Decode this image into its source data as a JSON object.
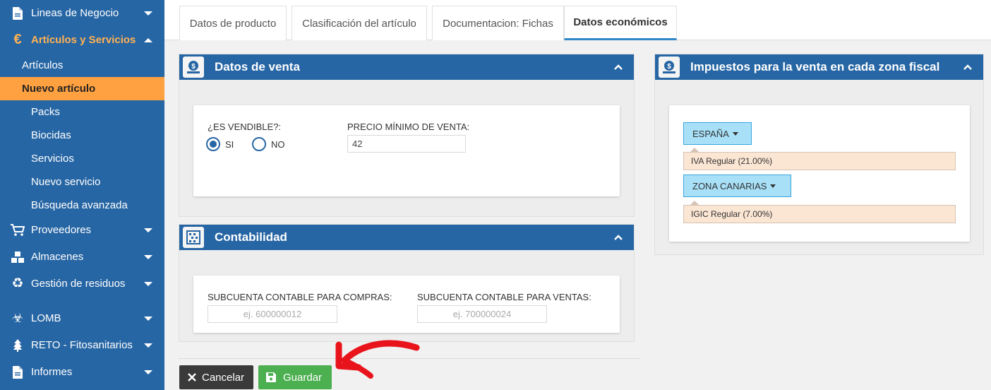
{
  "sidebar": {
    "groups": [
      {
        "label": "Lineas de Negocio",
        "icon": "document-icon"
      },
      {
        "label": "Artículos y Servicios",
        "icon": "euro-icon"
      },
      {
        "label": "Proveedores",
        "icon": "cart-icon"
      },
      {
        "label": "Almacenes",
        "icon": "boxes-icon"
      },
      {
        "label": "Gestión de residuos",
        "icon": "recycle-icon"
      },
      {
        "label": "LOMB",
        "icon": "biohazard-icon"
      },
      {
        "label": "RETO - Fitosanitarios",
        "icon": "tree-icon"
      },
      {
        "label": "Informes",
        "icon": "report-icon"
      }
    ],
    "subitems": [
      "Artículos",
      "Nuevo artículo",
      "Packs",
      "Biocidas",
      "Servicios",
      "Nuevo servicio",
      "Búsqueda avanzada"
    ]
  },
  "tabs": [
    "Datos de producto",
    "Clasificación del artículo",
    "Documentacion: Fichas",
    "Datos económicos"
  ],
  "venta": {
    "title": "Datos de venta",
    "vendible_label": "¿ES VENDIBLE?:",
    "si_label": "SI",
    "no_label": "NO",
    "vendible_value": "SI",
    "precio_label": "PRECIO MÍNIMO DE VENTA:",
    "precio_value": "42"
  },
  "contabilidad": {
    "title": "Contabilidad",
    "compras_label": "SUBCUENTA CONTABLE PARA COMPRAS:",
    "compras_placeholder": "ej. 600000012",
    "ventas_label": "SUBCUENTA CONTABLE PARA VENTAS:",
    "ventas_placeholder": "ej. 700000024"
  },
  "impuestos": {
    "title": "Impuestos para la venta en cada zona fiscal",
    "zones": [
      {
        "name": "ESPAÑA",
        "tax": "IVA Regular (21.00%)"
      },
      {
        "name": "ZONA CANARIAS",
        "tax": "IGIC Regular (7.00%)"
      }
    ]
  },
  "actions": {
    "cancel_label": "Cancelar",
    "save_label": "Guardar"
  },
  "colors": {
    "sidebar": "#2766a4",
    "selected_item": "#ffa140",
    "active_group_text": "#ffb253",
    "save": "#4caf50",
    "cancel": "#3a3a3a",
    "annotation_arrow": "#e8131b"
  }
}
